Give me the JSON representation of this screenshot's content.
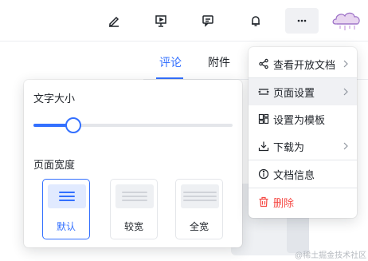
{
  "toolbar": {
    "icons": [
      "edit-icon",
      "present-icon",
      "comment-icon",
      "bell-icon",
      "more-icon"
    ],
    "more_label": "···"
  },
  "side_tabs": {
    "comment": "评论",
    "attachment": "附件"
  },
  "context_menu": {
    "items": [
      {
        "label": "查看开放文档",
        "icon": "share-icon",
        "submenu": true
      },
      {
        "label": "页面设置",
        "icon": "page-settings-icon",
        "submenu": true,
        "active": true
      },
      {
        "label": "设置为模板",
        "icon": "template-icon",
        "submenu": false
      },
      {
        "label": "下载为",
        "icon": "download-icon",
        "submenu": true
      },
      {
        "label": "文档信息",
        "icon": "info-icon",
        "submenu": false
      },
      {
        "label": "删除",
        "icon": "trash-icon",
        "submenu": false,
        "danger": true
      }
    ]
  },
  "page_settings": {
    "font_size_title": "文字大小",
    "font_size_level": 0.2,
    "page_width_title": "页面宽度",
    "width_options": [
      {
        "label": "默认",
        "selected": true
      },
      {
        "label": "较宽",
        "selected": false
      },
      {
        "label": "全宽",
        "selected": false
      }
    ]
  },
  "watermark": "@稀土掘金技术社区",
  "colors": {
    "accent": "#3370ff",
    "danger": "#f54a45"
  }
}
